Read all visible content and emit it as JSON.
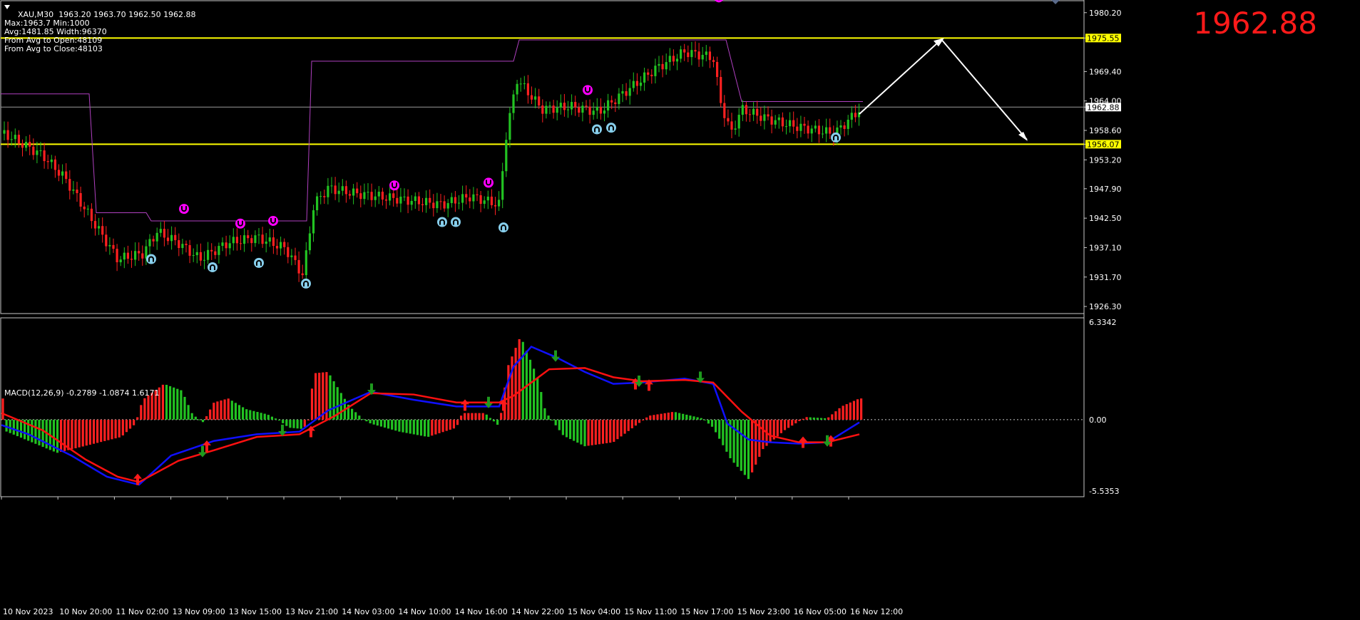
{
  "header": {
    "symbol": "XAU,M30",
    "ohlc": "1963.20 1963.70 1962.50 1962.88",
    "lines": [
      "Max:1963.7 Min:1000",
      "Avg:1481.85 Width:96370",
      "From Avg to Open:48109",
      "From Avg to Close:48103"
    ],
    "big_price": "1962.88"
  },
  "price_axis": {
    "labels": [
      "1980.20",
      "1975.55",
      "1969.40",
      "1964.00",
      "1962.88",
      "1958.60",
      "1956.07",
      "1953.20",
      "1947.90",
      "1942.50",
      "1937.10",
      "1931.70",
      "1926.30"
    ],
    "level_labels": {
      "upper": "1975.55",
      "current": "1962.88",
      "lower": "1956.07"
    },
    "range": [
      1925.0,
      1982.0
    ]
  },
  "macd": {
    "title": "MACD(12,26,9) -0.2789 -1.0874 1.6171",
    "axis_labels": [
      "6.3342",
      "0.00",
      "-5.5353"
    ],
    "range": [
      -5.5353,
      6.3342
    ]
  },
  "time_axis": {
    "labels": [
      "10 Nov 2023",
      "10 Nov 20:00",
      "11 Nov 02:00",
      "13 Nov 09:00",
      "13 Nov 15:00",
      "13 Nov 21:00",
      "14 Nov 03:00",
      "14 Nov 10:00",
      "14 Nov 16:00",
      "14 Nov 22:00",
      "15 Nov 04:00",
      "15 Nov 11:00",
      "15 Nov 17:00",
      "15 Nov 23:00",
      "16 Nov 05:00",
      "16 Nov 12:00"
    ]
  },
  "colors": {
    "bull": "#22c322",
    "bear": "#ff2020",
    "level": "#ffff00",
    "step": "#b040c0",
    "macd_line": "#1010ff",
    "signal_line": "#ff1010",
    "up_fractal": "#87ceeb",
    "down_fractal": "#ff00ff",
    "big_price": "#ff1a1a"
  }
}
